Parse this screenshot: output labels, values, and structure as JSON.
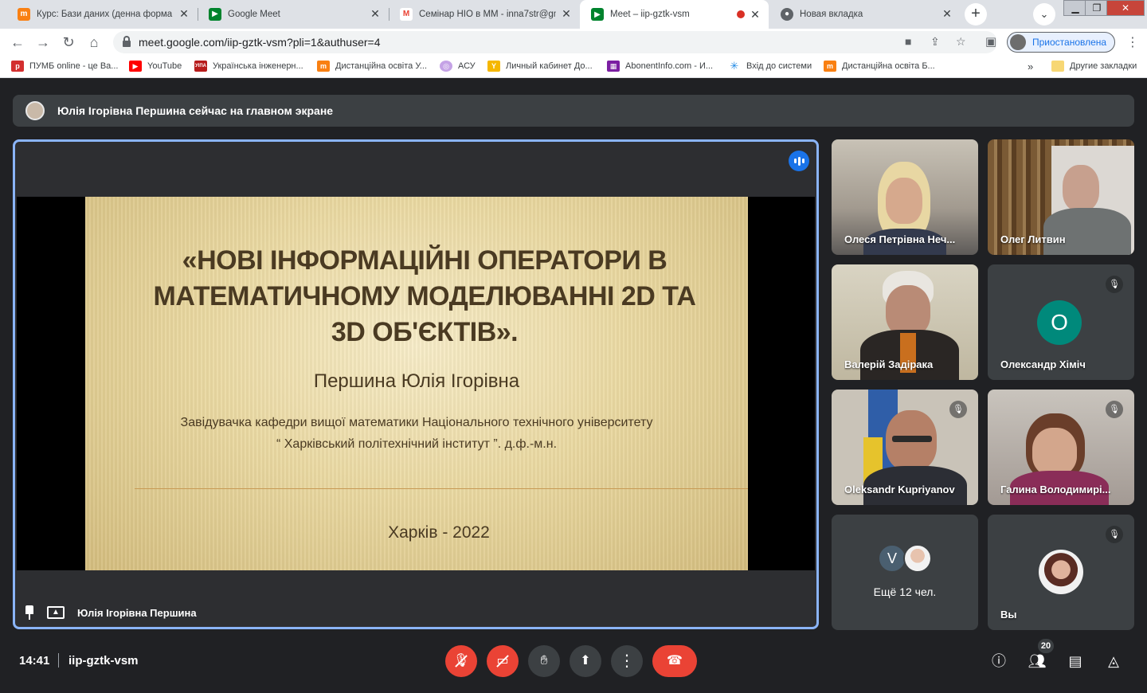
{
  "browser": {
    "tabs": [
      {
        "title": "Курс: Бази даних (денна форма на",
        "favicon": "moodle-icon",
        "color": "#f98012",
        "glyph": "m"
      },
      {
        "title": "Google Meet",
        "favicon": "meet-icon",
        "color": "#00832d",
        "glyph": "▶"
      },
      {
        "title": "Семінар НІО в ММ - inna7str@gma",
        "favicon": "gmail-icon",
        "color": "#ea4335",
        "glyph": "M"
      },
      {
        "title": "Meet – iip-gztk-vsm",
        "favicon": "meet-icon",
        "color": "#00832d",
        "glyph": "▶",
        "active": true,
        "recording": true
      },
      {
        "title": "Новая вкладка",
        "favicon": "chrome-icon",
        "color": "#5f6368",
        "glyph": "●"
      }
    ],
    "url": "meet.google.com/iip-gztk-vsm?pli=1&authuser=4",
    "profile_label": "Приостановлена",
    "bookmarks": [
      {
        "label": "ПУМБ online - це Ва...",
        "color": "#d32f2f",
        "glyph": "p"
      },
      {
        "label": "YouTube",
        "color": "#ff0000",
        "glyph": "▶"
      },
      {
        "label": "Українська інженерн...",
        "color": "#b71c1c",
        "glyph": "УІПА"
      },
      {
        "label": "Дистанційна освіта У...",
        "color": "#f98012",
        "glyph": "m"
      },
      {
        "label": "АСУ",
        "color": "#c5a3e6",
        "glyph": "◎"
      },
      {
        "label": "Личный кабинет До...",
        "color": "#f5b700",
        "glyph": "Y"
      },
      {
        "label": "AbonentInfo.com - И...",
        "color": "#7b1fa2",
        "glyph": "▦"
      },
      {
        "label": "Вхід до системи",
        "color": "#1e88e5",
        "glyph": "✳"
      },
      {
        "label": "Дистанційна освіта Б...",
        "color": "#f98012",
        "glyph": "m"
      }
    ],
    "other_bookmarks": "Другие закладки",
    "overflow": "»"
  },
  "meet": {
    "banner": "Юлія Ігорівна Першина сейчас на главном экране",
    "presenter_name": "Юлія Ігорівна Першина",
    "slide": {
      "title": "«НОВІ ІНФОРМАЦІЙНІ ОПЕРАТОРИ В МАТЕМАТИЧНОМУ МОДЕЛЮВАННІ 2D ТА 3D ОБ'ЄКТІВ».",
      "author": "Першина Юлія Ігорівна",
      "position_line1": "Завідувачка кафедри вищої математики Національного технічного університету",
      "position_line2": "“ Харківський політехнічний інститут ”. д.ф.-м.н.",
      "city": "Харків - 2022"
    },
    "participants": [
      {
        "name": "Олеся Петрівна Неч...",
        "muted": false
      },
      {
        "name": "Олег Литвин",
        "muted": false
      },
      {
        "name": "Валерій Задірака",
        "muted": false
      },
      {
        "name": "Олександр Хіміч",
        "muted": true,
        "initial": "О"
      },
      {
        "name": "Oleksandr Kupriyanov",
        "muted": true
      },
      {
        "name": "Галина Володимирі...",
        "muted": true
      },
      {
        "more_label": "Ещё 12 чел.",
        "initial": "V"
      },
      {
        "name": "Вы",
        "muted": true
      }
    ],
    "time": "14:41",
    "meeting_code": "iip-gztk-vsm",
    "participant_count": "20"
  }
}
